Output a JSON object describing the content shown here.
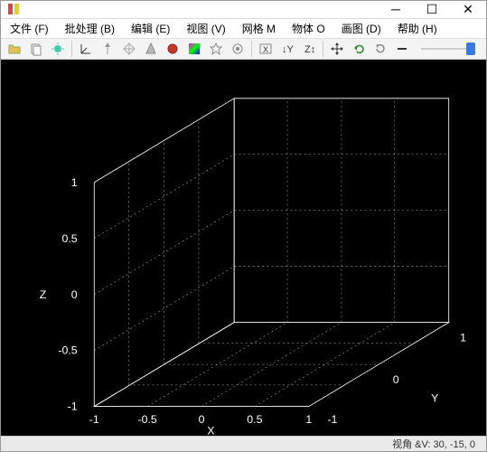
{
  "window": {
    "title": ""
  },
  "menu": {
    "file": "文件 (F)",
    "batch": "批处理 (B)",
    "edit": "编辑 (E)",
    "view": "视图 (V)",
    "grid": "网格 M",
    "object": "物体 O",
    "image": "画图 (D)",
    "help": "帮助 (H)"
  },
  "chart_data": {
    "type": "scatter",
    "title": "",
    "xlabel": "X",
    "ylabel": "Y",
    "zlabel": "Z",
    "x_ticks": [
      -1,
      -0.5,
      0,
      0.5,
      1
    ],
    "y_ticks": [
      -1,
      0,
      1
    ],
    "z_ticks": [
      -1,
      -0.5,
      0,
      0.5,
      1
    ],
    "xlim": [
      -1,
      1
    ],
    "ylim": [
      -1,
      1
    ],
    "zlim": [
      -1,
      1
    ],
    "series": [],
    "view": {
      "azimuth": 30,
      "elevation": -15,
      "roll": 0
    }
  },
  "status": {
    "view_label": "视角 &V: 30, -15, 0"
  }
}
